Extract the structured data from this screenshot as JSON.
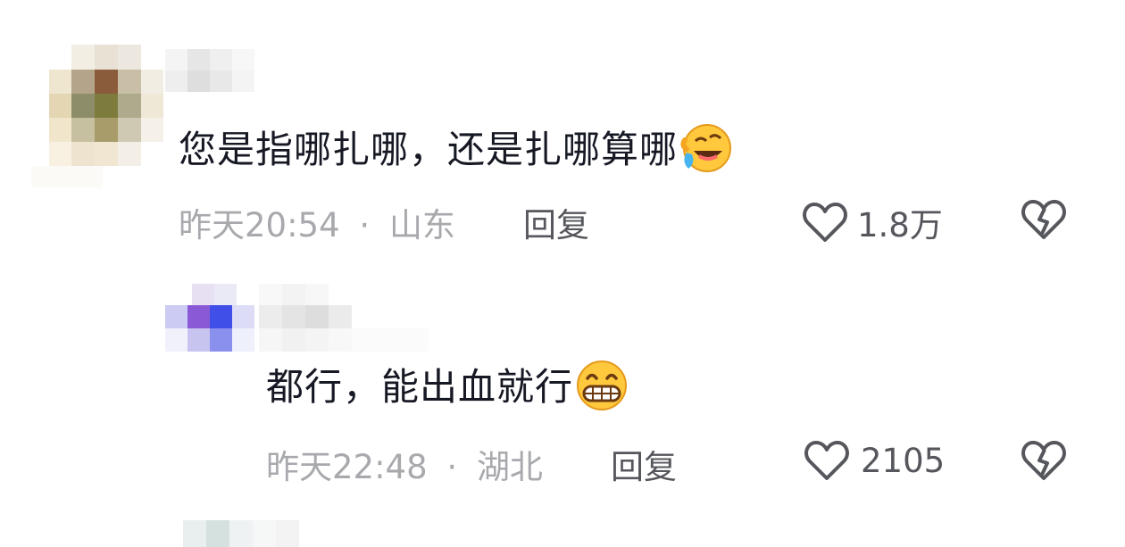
{
  "comments": [
    {
      "text": "您是指哪扎哪，还是扎哪算哪",
      "emoji": "laughing-crying-emoji",
      "time": "昨天20:54",
      "separator": "·",
      "location": "山东",
      "reply_label": "回复",
      "likes": "1.8万"
    },
    {
      "text": "都行，能出血就行",
      "emoji": "grinning-emoji",
      "time": "昨天22:48",
      "separator": "·",
      "location": "湖北",
      "reply_label": "回复",
      "likes": "2105"
    }
  ],
  "colors": {
    "text": "#161823",
    "meta": "#a8a9ad",
    "action": "#56575d",
    "emoji_yellow": "#ffc83d"
  }
}
